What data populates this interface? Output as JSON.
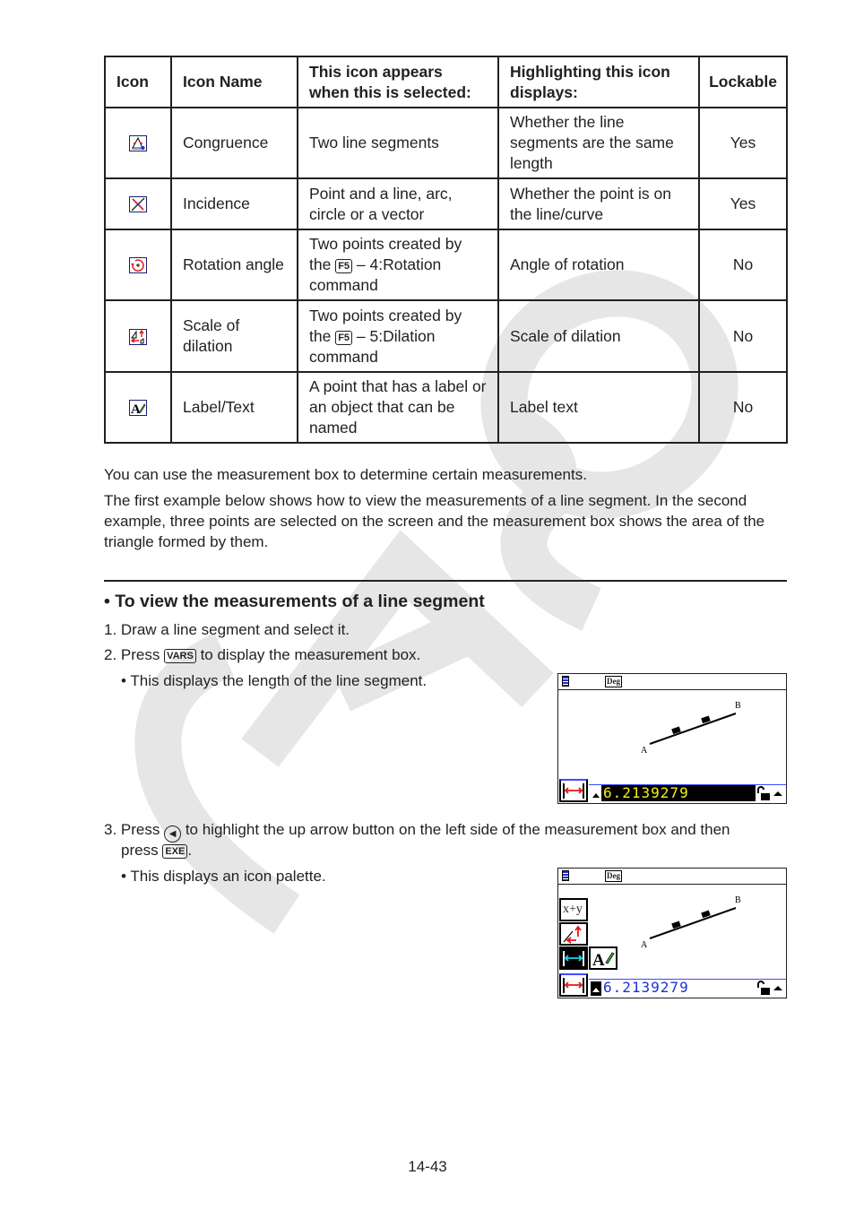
{
  "watermark": "CASIO",
  "table": {
    "headers": {
      "icon": "Icon",
      "icon_name": "Icon Name",
      "appears_when": "This icon appears when this is selected:",
      "displays": "Highlighting this icon displays:",
      "lockable": "Lockable"
    },
    "rows": [
      {
        "icon": "congruence-icon",
        "name": "Congruence",
        "appears_when": "Two line segments",
        "displays": "Whether the line segments are the same length",
        "lockable": "Yes"
      },
      {
        "icon": "incidence-icon",
        "name": "Incidence",
        "appears_when": "Point and a line, arc, circle or a vector",
        "displays": "Whether the point is on the line/curve",
        "lockable": "Yes"
      },
      {
        "icon": "rotation-angle-icon",
        "name": "Rotation angle",
        "appears_when_pre": "Two points created by the",
        "appears_key": "F5",
        "appears_when_post": "– 4:Rotation command",
        "displays": "Angle of rotation",
        "lockable": "No"
      },
      {
        "icon": "scale-of-dilation-icon",
        "name": "Scale of dilation",
        "appears_when_pre": "Two points created by the",
        "appears_key": "F5",
        "appears_when_post": "– 5:Dilation command",
        "displays": "Scale of dilation",
        "lockable": "No"
      },
      {
        "icon": "label-text-icon",
        "name": "Label/Text",
        "appears_when": "A point that has a label or an object that can be named",
        "displays": "Label text",
        "lockable": "No"
      }
    ]
  },
  "paragraphs": [
    "You can use the measurement box to determine certain measurements.",
    "The first example below shows how to view the measurements of a line segment. In the second example, three points are selected on the screen and the measurement box shows the area of the triangle formed by them."
  ],
  "section": {
    "heading": "• To view the measurements of a line segment",
    "step1": "1. Draw a line segment and select it.",
    "step2_pre": "2. Press",
    "step2_key": "VARS",
    "step2_post": "to display the measurement box.",
    "step2_bullet": "• This displays the length of the line segment.",
    "step3_pre": "3. Press",
    "step3_key": "◀",
    "step3_post": "to highlight the up arrow button on the left side of the measurement box and then",
    "step3_line2_pre": "press",
    "step3_line2_key": "EXE",
    "step3_line2_post": ".",
    "step3_bullet": "• This displays an icon palette."
  },
  "screen1": {
    "status_mode": "Deg",
    "point_a": "A",
    "point_b": "B",
    "measurement_value": "6.2139279",
    "value_color": "#f6f016"
  },
  "screen2": {
    "status_mode": "Deg",
    "point_a": "A",
    "point_b": "B",
    "palette_sum_label": "x+y",
    "measurement_value": "6.2139279",
    "value_color": "#1b30d6"
  },
  "page_number": "14-43"
}
